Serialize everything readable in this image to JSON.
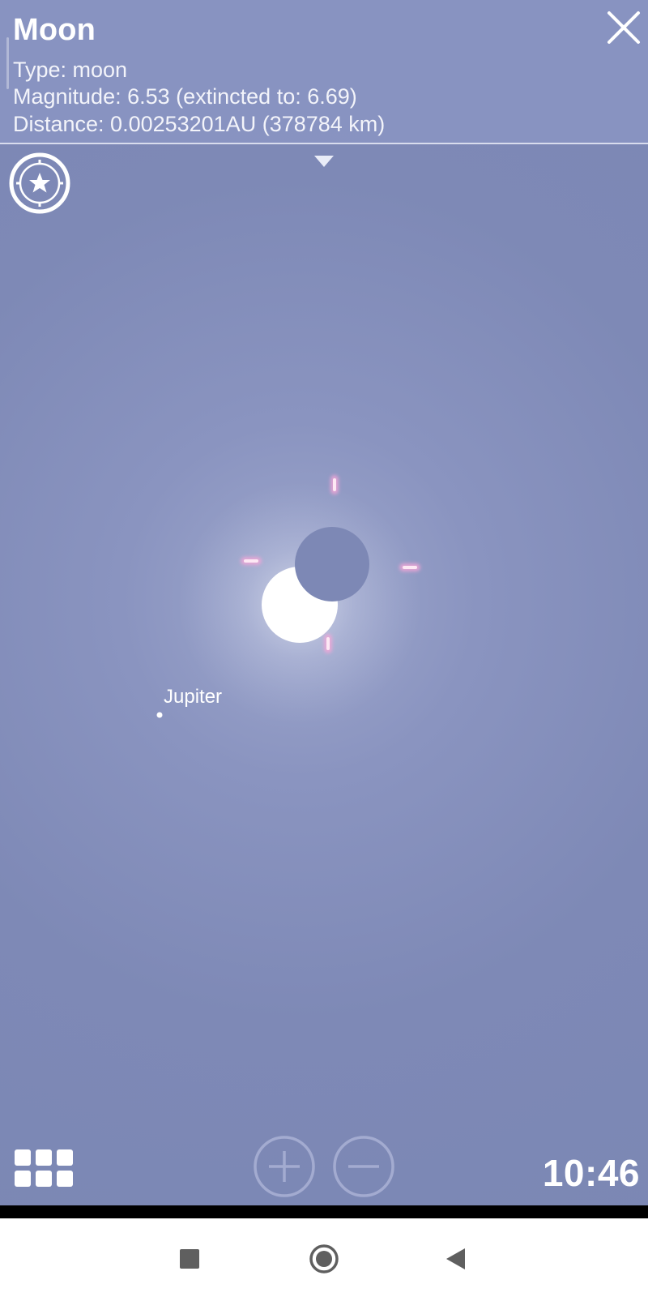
{
  "info_panel": {
    "title": "Moon",
    "type_line": "Type: moon",
    "magnitude_line": "Magnitude: 6.53 (extincted to: 6.69)",
    "distance_line": "Distance: 0.00253201AU (378784 km)"
  },
  "sky": {
    "labels": {
      "jupiter": "Jupiter"
    },
    "colors": {
      "background": "#7c88b5",
      "selection_marker": "#f6a6d8"
    }
  },
  "controls": {
    "close_icon": "close-icon",
    "favorites_icon": "star-compass-icon",
    "menu_icon": "grid-icon",
    "zoom_in_icon": "plus-circle-icon",
    "zoom_out_icon": "minus-circle-icon"
  },
  "clock": {
    "time": "10:46"
  },
  "nav_bar": {
    "recents_icon": "square-icon",
    "home_icon": "circle-icon",
    "back_icon": "triangle-back-icon"
  }
}
